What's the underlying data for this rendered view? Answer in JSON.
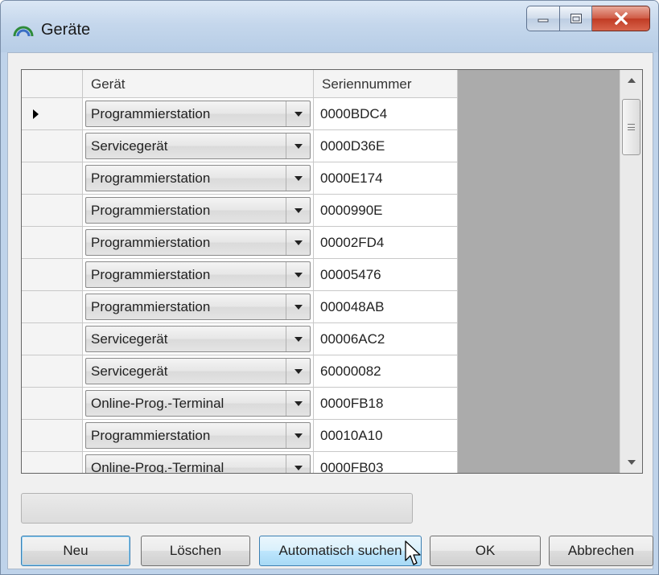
{
  "window": {
    "title": "Geräte",
    "icons": {
      "app": "rainbow-arc-icon",
      "minimize": "minimize-icon",
      "maximize": "maximize-icon",
      "close": "close-icon"
    }
  },
  "grid": {
    "columns": {
      "device": "Gerät",
      "serial": "Seriennummer"
    },
    "rows": [
      {
        "device": "Programmierstation",
        "serial": "0000BDC4",
        "current": true
      },
      {
        "device": "Servicegerät",
        "serial": "0000D36E"
      },
      {
        "device": "Programmierstation",
        "serial": "0000E174"
      },
      {
        "device": "Programmierstation",
        "serial": "0000990E"
      },
      {
        "device": "Programmierstation",
        "serial": "00002FD4"
      },
      {
        "device": "Programmierstation",
        "serial": "00005476"
      },
      {
        "device": "Programmierstation",
        "serial": "000048AB"
      },
      {
        "device": "Servicegerät",
        "serial": "00006AC2"
      },
      {
        "device": "Servicegerät",
        "serial": "60000082"
      },
      {
        "device": "Online-Prog.-Terminal",
        "serial": "0000FB18"
      },
      {
        "device": "Programmierstation",
        "serial": "00010A10"
      },
      {
        "device": "Online-Prog.-Terminal",
        "serial": "0000FB03"
      }
    ]
  },
  "progress": {
    "value": 0
  },
  "buttons": {
    "new": "Neu",
    "delete": "Löschen",
    "auto_search": "Automatisch suchen",
    "ok": "OK",
    "cancel": "Abbrechen"
  },
  "colors": {
    "titlebar": "#c5d7ec",
    "close_button": "#c03b24",
    "grid_background": "#ababab",
    "hover_button": "#bee6fd"
  }
}
